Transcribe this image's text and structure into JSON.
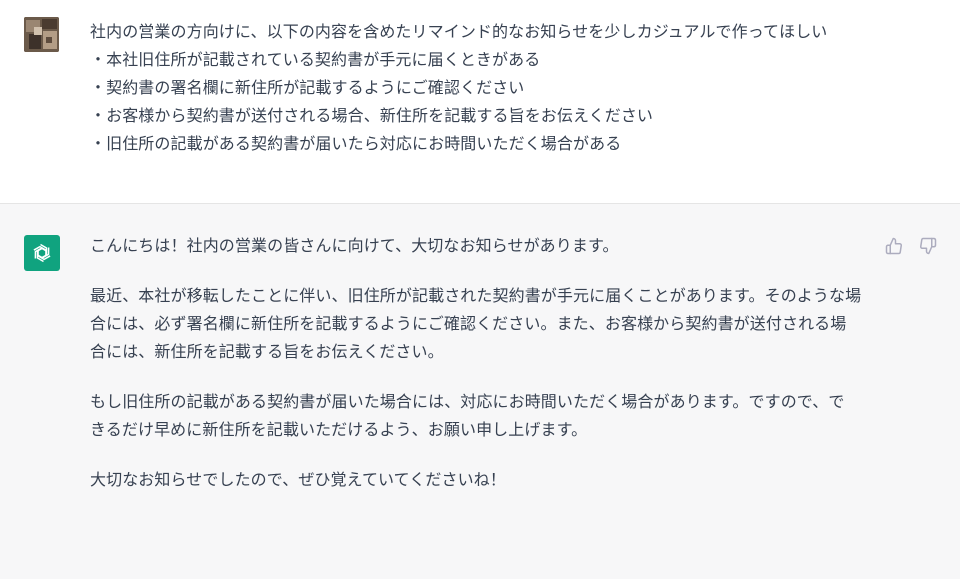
{
  "user_message": {
    "avatar": "user-photo-avatar",
    "lines": [
      "社内の営業の方向けに、以下の内容を含めたリマインド的なお知らせを少しカジュアルで作ってほしい",
      "・本社旧住所が記載されている契約書が手元に届くときがある",
      "・契約書の署名欄に新住所が記載するようにご確認ください",
      "・お客様から契約書が送付される場合、新住所を記載する旨をお伝えください",
      "・旧住所の記載がある契約書が届いたら対応にお時間いただく場合がある"
    ]
  },
  "assistant_message": {
    "avatar": "openai-logo-icon",
    "accent_color": "#10a37f",
    "paragraphs": [
      {
        "lines": [
          "こんにちは！社内の営業の皆さんに向けて、大切なお知らせがあります。"
        ]
      },
      {
        "lines": [
          "最近、本社が移転したことに伴い、旧住所が記載された契約書が手元に届くことがあります。そのような場",
          "合には、必ず署名欄に新住所を記載するようにご確認ください。また、お客様から契約書が送付される場",
          "合には、新住所を記載する旨をお伝えください。"
        ]
      },
      {
        "lines": [
          "もし旧住所の記載がある契約書が届いた場合には、対応にお時間いただく場合があります。ですので、で",
          "きるだけ早めに新住所を記載いただけるよう、お願い申し上げます。"
        ]
      },
      {
        "lines": [
          "大切なお知らせでしたので、ぜひ覚えていてくださいね！"
        ]
      }
    ],
    "feedback": {
      "thumbs_up_icon": "thumbs-up-icon",
      "thumbs_down_icon": "thumbs-down-icon"
    }
  }
}
